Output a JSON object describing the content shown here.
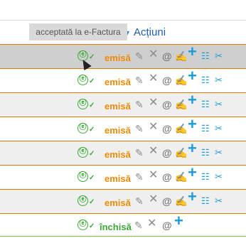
{
  "header": {
    "actions_label": "Acțiuni"
  },
  "tooltip": {
    "text": "acceptată la e-Factura"
  },
  "icons": {
    "efactura": "ⓔ",
    "check": "✓",
    "edit": "✎",
    "delete": "✕",
    "email": "@",
    "payment": "✍",
    "add": "+",
    "invoice": "☷",
    "more": "✂"
  },
  "rows": [
    {
      "status": "emisă"
    },
    {
      "status": "emisă"
    },
    {
      "status": "emisă"
    },
    {
      "status": "emisă"
    },
    {
      "status": "emisă"
    },
    {
      "status": "emisă"
    },
    {
      "status": "emisă"
    },
    {
      "status": "închisă"
    }
  ],
  "colors": {
    "issued": "#f08a00",
    "closed": "#3aaa35",
    "accent_blue": "#1c9bd8",
    "row_separator": "#e07b00"
  }
}
